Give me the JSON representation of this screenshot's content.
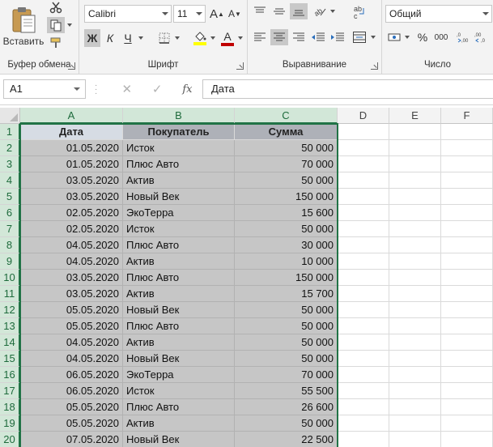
{
  "ribbon": {
    "clipboard": {
      "paste_label": "Вставить",
      "group_label": "Буфер обмена"
    },
    "font": {
      "font_name": "Calibri",
      "font_size": "11",
      "bold": "Ж",
      "italic": "К",
      "underline": "Ч",
      "group_label": "Шрифт",
      "grow": "A",
      "shrink": "A",
      "font_color_letter": "A",
      "font_color": "#c00000",
      "fill_color": "#ffff00"
    },
    "alignment": {
      "group_label": "Выравнивание"
    },
    "number": {
      "format": "Общий",
      "percent": "%",
      "thousands": "000",
      "group_label": "Число"
    }
  },
  "formula_bar": {
    "name_box": "A1",
    "content": "Дата",
    "fx": "fx"
  },
  "columns": [
    "A",
    "B",
    "C",
    "D",
    "E",
    "F"
  ],
  "headers": {
    "date": "Дата",
    "buyer": "Покупатель",
    "sum": "Сумма"
  },
  "rows": [
    {
      "n": "1"
    },
    {
      "n": "2",
      "date": "01.05.2020",
      "buyer": "Исток",
      "sum": "50 000"
    },
    {
      "n": "3",
      "date": "01.05.2020",
      "buyer": "Плюс Авто",
      "sum": "70 000"
    },
    {
      "n": "4",
      "date": "03.05.2020",
      "buyer": "Актив",
      "sum": "50 000"
    },
    {
      "n": "5",
      "date": "03.05.2020",
      "buyer": "Новый Век",
      "sum": "150 000"
    },
    {
      "n": "6",
      "date": "02.05.2020",
      "buyer": "ЭкоТерра",
      "sum": "15 600"
    },
    {
      "n": "7",
      "date": "02.05.2020",
      "buyer": "Исток",
      "sum": "50 000"
    },
    {
      "n": "8",
      "date": "04.05.2020",
      "buyer": "Плюс Авто",
      "sum": "30 000"
    },
    {
      "n": "9",
      "date": "04.05.2020",
      "buyer": "Актив",
      "sum": "10 000"
    },
    {
      "n": "10",
      "date": "03.05.2020",
      "buyer": "Плюс Авто",
      "sum": "150 000"
    },
    {
      "n": "11",
      "date": "03.05.2020",
      "buyer": "Актив",
      "sum": "15 700"
    },
    {
      "n": "12",
      "date": "05.05.2020",
      "buyer": "Новый Век",
      "sum": "50 000"
    },
    {
      "n": "13",
      "date": "05.05.2020",
      "buyer": "Плюс Авто",
      "sum": "50 000"
    },
    {
      "n": "14",
      "date": "04.05.2020",
      "buyer": "Актив",
      "sum": "50 000"
    },
    {
      "n": "15",
      "date": "04.05.2020",
      "buyer": "Новый Век",
      "sum": "50 000"
    },
    {
      "n": "16",
      "date": "06.05.2020",
      "buyer": "ЭкоТерра",
      "sum": "70 000"
    },
    {
      "n": "17",
      "date": "06.05.2020",
      "buyer": "Исток",
      "sum": "55 500"
    },
    {
      "n": "18",
      "date": "05.05.2020",
      "buyer": "Плюс Авто",
      "sum": "26 600"
    },
    {
      "n": "19",
      "date": "05.05.2020",
      "buyer": "Актив",
      "sum": "50 000"
    },
    {
      "n": "20",
      "date": "07.05.2020",
      "buyer": "Новый Век",
      "sum": "22 500"
    }
  ],
  "colors": {
    "accent": "#217346",
    "selection": "#c6c6c6"
  }
}
